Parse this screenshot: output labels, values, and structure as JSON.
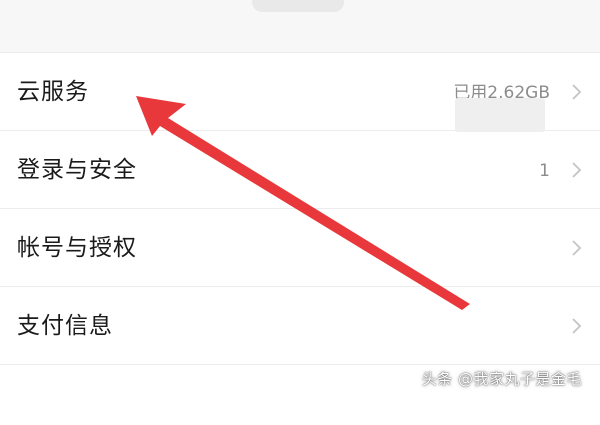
{
  "settings": {
    "items": [
      {
        "label": "云服务",
        "value": "已用2.62GB"
      },
      {
        "label": "登录与安全",
        "value": "1"
      },
      {
        "label": "帐号与授权",
        "value": ""
      },
      {
        "label": "支付信息",
        "value": ""
      }
    ]
  },
  "overlay": {
    "watermark": "头条 @我家丸子是金毛",
    "arrow_color": "#e8383b"
  }
}
